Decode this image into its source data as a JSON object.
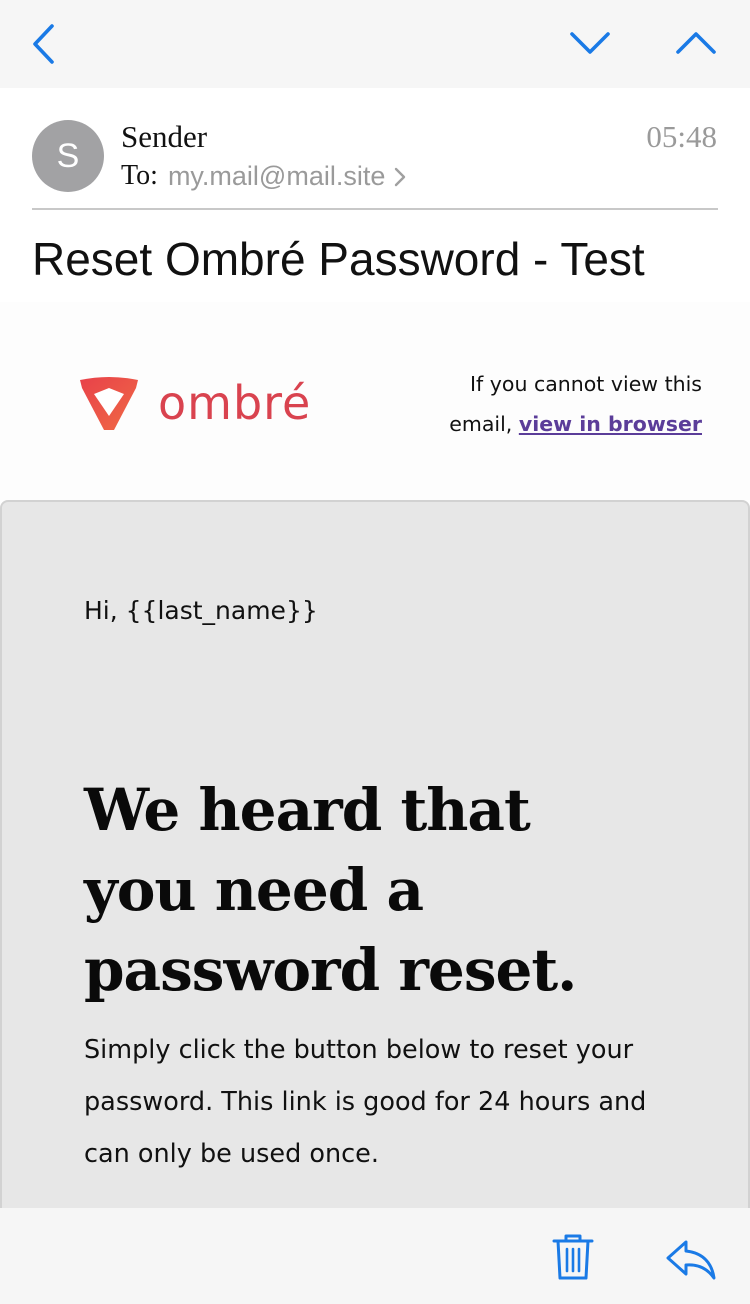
{
  "colors": {
    "accent": "#1a7ae6",
    "brand": "#d9434f",
    "link": "#5b3d99",
    "card_background": "#e7e7e7"
  },
  "top_bar": {
    "icons": [
      "chevron-left-icon",
      "chevron-down-icon",
      "chevron-up-icon"
    ]
  },
  "header": {
    "avatar_initial": "S",
    "sender": "Sender",
    "time": "05:48",
    "to_label": "To:",
    "to_address": "my.mail@mail.site",
    "subject": "Reset Ombré Password - Test"
  },
  "email": {
    "brand_name": "ombré",
    "view_browser_prefix": "If you cannot view this email,",
    "view_browser_link": "view in browser",
    "greeting": "Hi, {{last_name}}",
    "heading": "We heard that you need a password reset.",
    "body": "Simply click the button below to reset your password. This link is good for 24 hours and can only be used once."
  },
  "bottom_bar": {
    "icons": [
      "trash-icon",
      "reply-icon"
    ]
  }
}
